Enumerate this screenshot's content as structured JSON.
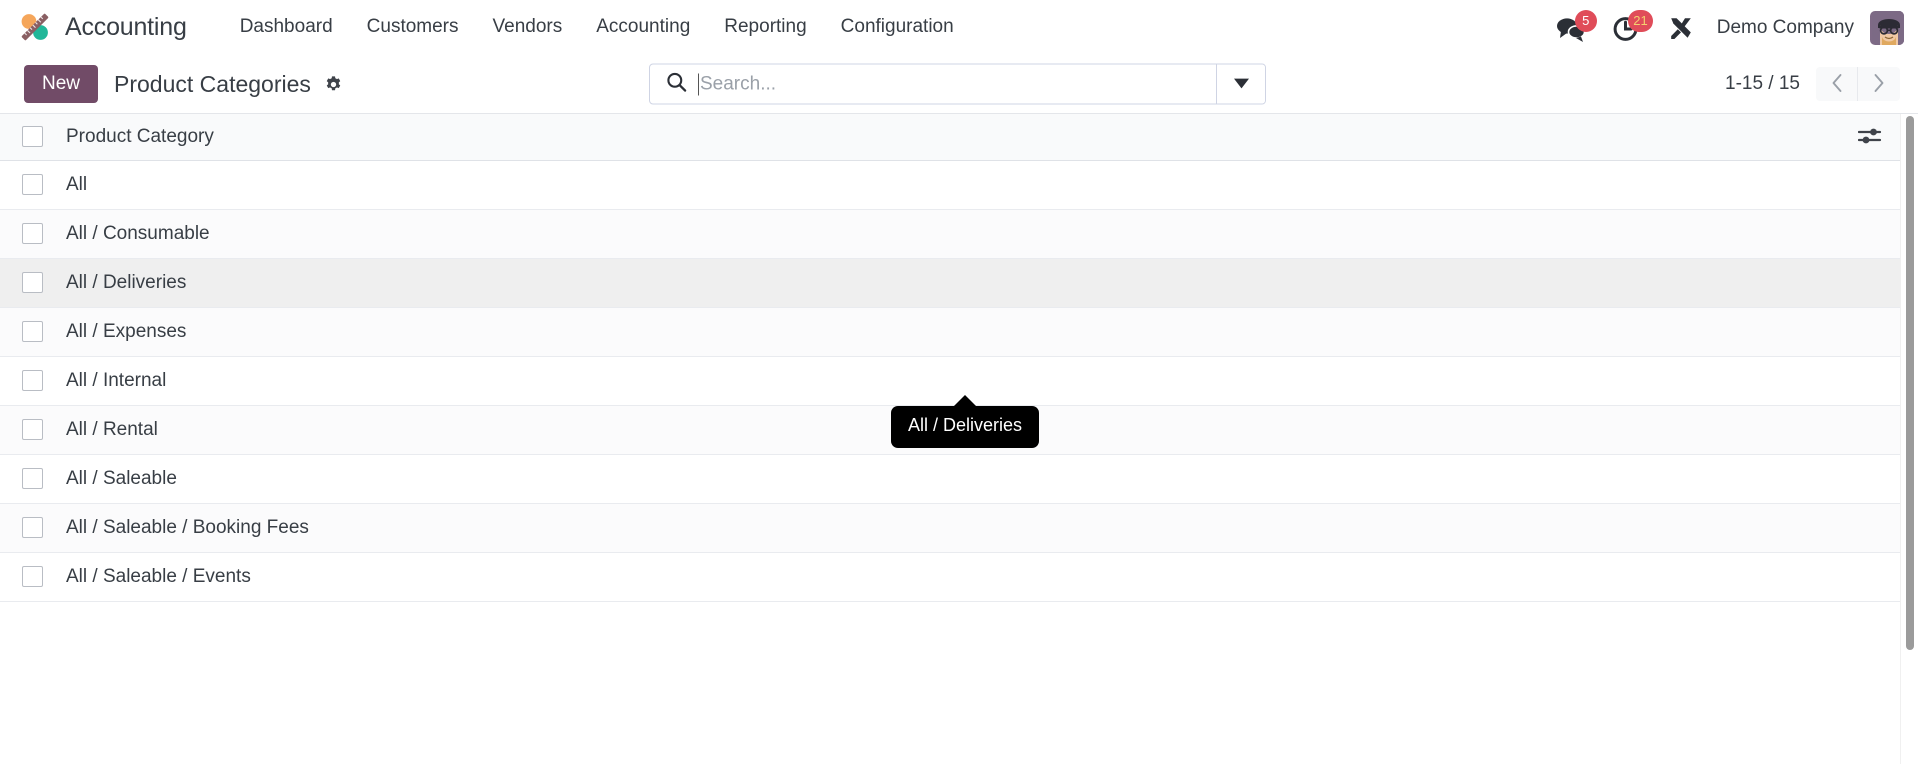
{
  "navbar": {
    "brand_name": "Accounting",
    "logo_icon": "accounting-app-logo",
    "menu_items": [
      {
        "label": "Dashboard"
      },
      {
        "label": "Customers"
      },
      {
        "label": "Vendors"
      },
      {
        "label": "Accounting"
      },
      {
        "label": "Reporting"
      },
      {
        "label": "Configuration"
      }
    ],
    "systray": {
      "messages_icon": "chat-bubbles-icon",
      "messages_count": "5",
      "activities_icon": "clock-icon",
      "activities_count": "21",
      "tools_icon": "wrench-screwdriver-icon",
      "company_name": "Demo Company",
      "avatar_icon": "user-avatar"
    }
  },
  "control_panel": {
    "new_label": "New",
    "breadcrumb_title": "Product Categories",
    "settings_icon": "gear-icon",
    "search": {
      "icon": "search-icon",
      "placeholder": "Search...",
      "value": "",
      "toggle_icon": "chevron-down-icon"
    },
    "pager": {
      "value": "1-15 / 15",
      "previous_icon": "chevron-left-icon",
      "next_icon": "chevron-right-icon"
    }
  },
  "list": {
    "columns": [
      "Product Category"
    ],
    "optional_columns_icon": "sliders-icon",
    "select_all_checkbox": false,
    "rows": [
      {
        "name": "All",
        "checked": false,
        "hovered": false
      },
      {
        "name": "All / Consumable",
        "checked": false,
        "hovered": false
      },
      {
        "name": "All / Deliveries",
        "checked": false,
        "hovered": true
      },
      {
        "name": "All / Expenses",
        "checked": false,
        "hovered": false
      },
      {
        "name": "All / Internal",
        "checked": false,
        "hovered": false
      },
      {
        "name": "All / Rental",
        "checked": false,
        "hovered": false
      },
      {
        "name": "All / Saleable",
        "checked": false,
        "hovered": false
      },
      {
        "name": "All / Saleable / Booking Fees",
        "checked": false,
        "hovered": false
      },
      {
        "name": "All / Saleable / Events",
        "checked": false,
        "hovered": false
      }
    ]
  },
  "tooltip": {
    "text": "All / Deliveries"
  },
  "colors": {
    "brand_primary": "#714b67",
    "badge_red": "#e04c59",
    "text_default": "#383e45",
    "logo_orange": "#f5a65b",
    "logo_teal": "#21b799",
    "logo_dark": "#8a5f63"
  }
}
